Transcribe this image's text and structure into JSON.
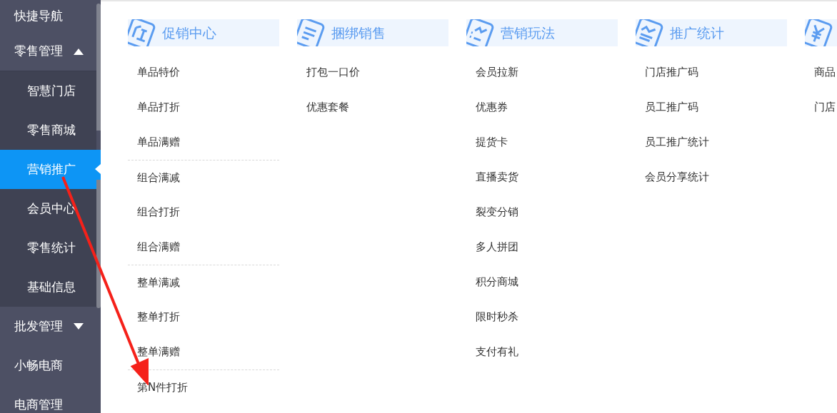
{
  "sidebar": {
    "items": [
      {
        "label": "快捷导航",
        "selected": false
      },
      {
        "label": "零售管理",
        "expanded": true,
        "selected": false,
        "children": [
          {
            "label": "智慧门店",
            "selected": false
          },
          {
            "label": "零售商城",
            "selected": false
          },
          {
            "label": "营销推广",
            "selected": true
          },
          {
            "label": "会员中心",
            "selected": false
          },
          {
            "label": "零售统计",
            "selected": false
          },
          {
            "label": "基础信息",
            "selected": false
          }
        ]
      },
      {
        "label": "批发管理",
        "expanded": false,
        "selected": false
      },
      {
        "label": "小畅电商",
        "selected": false
      },
      {
        "label": "电商管理",
        "selected": false
      }
    ]
  },
  "menu_columns": [
    {
      "kind": "promo",
      "title": "促销中心",
      "groups": [
        [
          "单品特价",
          "单品打折",
          "单品满赠"
        ],
        [
          "组合满减",
          "组合打折",
          "组合满赠"
        ],
        [
          "整单满减",
          "整单打折",
          "整单满赠"
        ],
        [
          "第N件打折"
        ]
      ]
    },
    {
      "kind": "bundle",
      "title": "捆绑销售",
      "groups": [
        [
          "打包一口价",
          "优惠套餐"
        ]
      ]
    },
    {
      "kind": "marketing",
      "title": "营销玩法",
      "groups": [
        [
          "会员拉新",
          "优惠券",
          "提货卡",
          "直播卖货",
          "裂变分销",
          "多人拼团",
          "积分商城",
          "限时秒杀",
          "支付有礼"
        ]
      ]
    },
    {
      "kind": "stats",
      "title": "推广统计",
      "groups": [
        [
          "门店推广码",
          "员工推广码",
          "员工推广统计",
          "会员分享统计"
        ]
      ]
    },
    {
      "kind": "money",
      "groups": [
        [
          "商品",
          "门店"
        ]
      ]
    }
  ]
}
